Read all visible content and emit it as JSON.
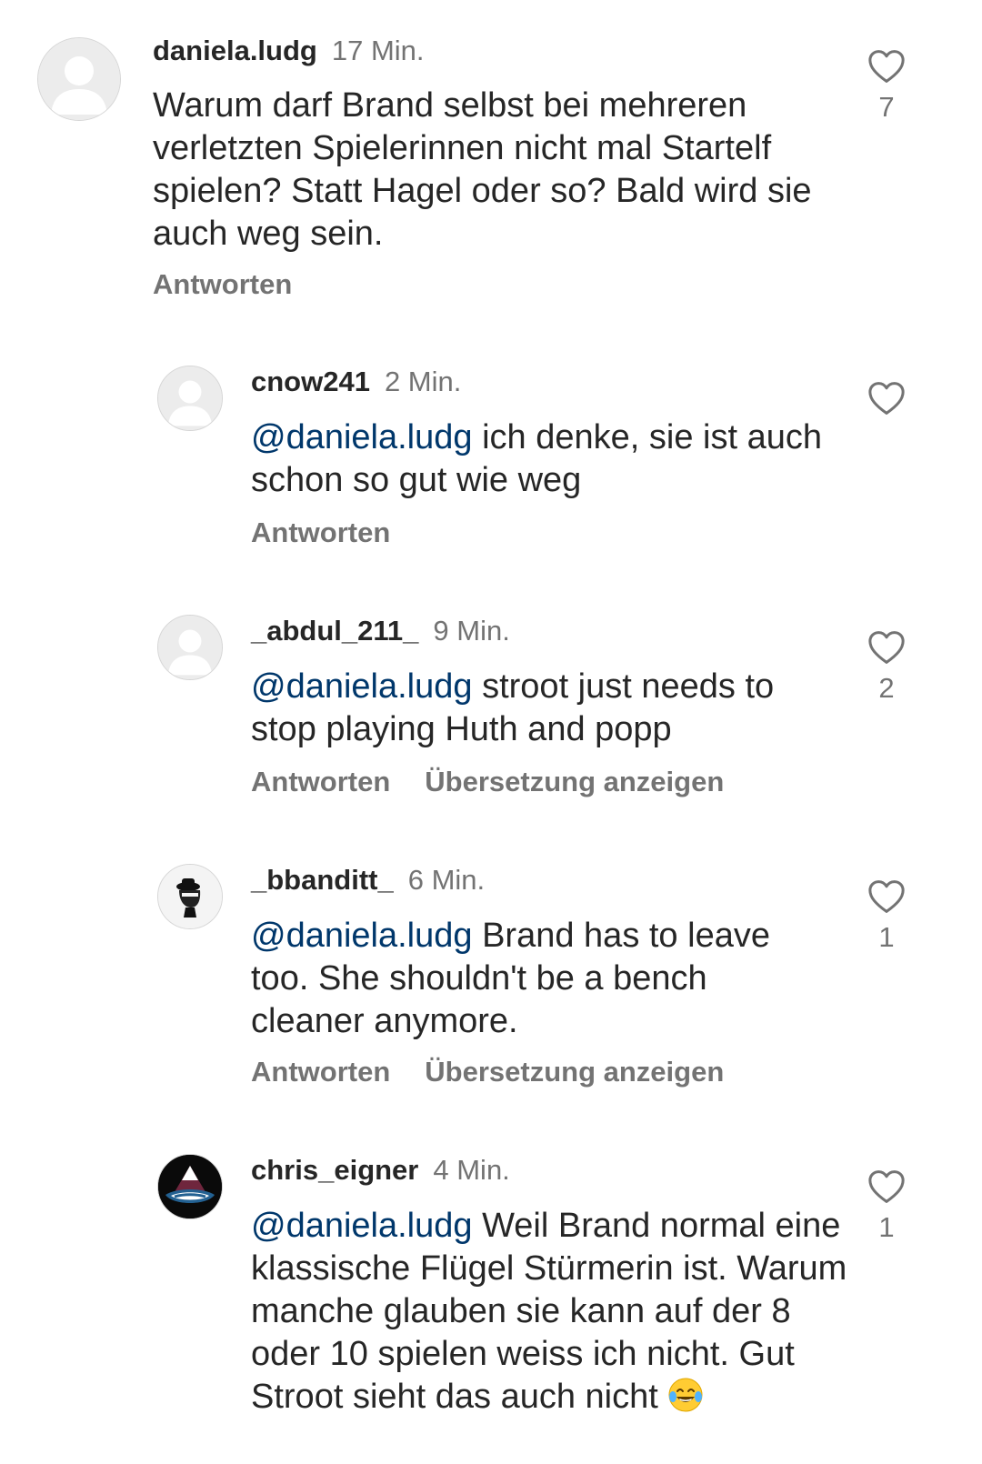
{
  "comments": [
    {
      "username": "daniela.ludg",
      "time": "17 Min.",
      "mention": "",
      "text": "Warum darf Brand selbst bei mehreren verletzten Spielerinnen nicht mal Startelf spielen? Statt Hagel oder so? Bald wird sie auch weg sein.",
      "reply_label": "Antworten",
      "translate_label": "",
      "like_count": "7",
      "avatar": "default-avatar-icon"
    },
    {
      "username": "cnow241",
      "time": "2 Min.",
      "mention": "@daniela.ludg",
      "text": " ich denke, sie ist auch schon so gut wie weg",
      "reply_label": "Antworten",
      "translate_label": "",
      "like_count": "",
      "avatar": "default-avatar-icon"
    },
    {
      "username": "_abdul_211_",
      "time": "9 Min.",
      "mention": "@daniela.ludg",
      "text": " stroot just needs to stop playing Huth and popp",
      "reply_label": "Antworten",
      "translate_label": "Übersetzung anzeigen",
      "like_count": "2",
      "avatar": "default-avatar-icon"
    },
    {
      "username": "_bbanditt_",
      "time": "6 Min.",
      "mention": "@daniela.ludg",
      "text": " Brand has to leave too. She shouldn't be a bench cleaner anymore.",
      "reply_label": "Antworten",
      "translate_label": "Übersetzung anzeigen",
      "like_count": "1",
      "avatar": "bandit-sketch-avatar-icon"
    },
    {
      "username": "chris_eigner",
      "time": "4 Min.",
      "mention": "@daniela.ludg",
      "text": " Weil Brand normal eine klassische Flügel Stürmerin ist. Warum manche glauben sie kann auf der 8 oder 10 spielen weiss ich nicht. Gut Stroot sieht das auch nicht",
      "emoji": "face-with-tears-of-joy-icon",
      "reply_label": "",
      "translate_label": "",
      "like_count": "1",
      "avatar": "avalanche-logo-avatar-icon"
    }
  ],
  "colors": {
    "text": "#262626",
    "secondary": "#737373",
    "mention": "#00376b",
    "background": "#ffffff"
  }
}
